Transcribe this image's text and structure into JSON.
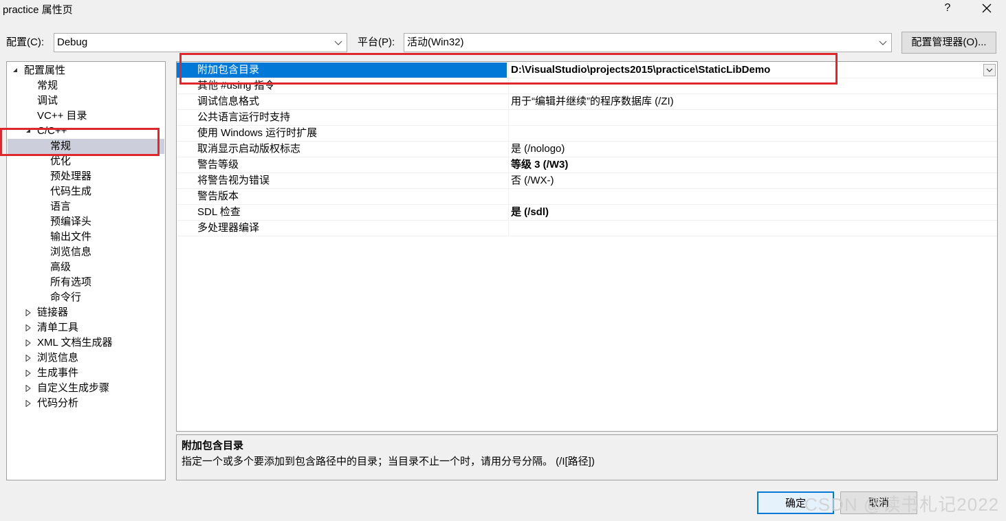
{
  "window": {
    "title": "practice 属性页",
    "help": "?",
    "close": "✕"
  },
  "toolbar": {
    "config_label": "配置(C):",
    "config_value": "Debug",
    "platform_label": "平台(P):",
    "platform_value": "活动(Win32)",
    "config_manager_label": "配置管理器(O)..."
  },
  "tree": {
    "root": "配置属性",
    "items": [
      "常规",
      "调试",
      "VC++ 目录"
    ],
    "cpp": {
      "label": "C/C++",
      "children": [
        "常规",
        "优化",
        "预处理器",
        "代码生成",
        "语言",
        "预编译头",
        "输出文件",
        "浏览信息",
        "高级",
        "所有选项",
        "命令行"
      ],
      "selected": "常规"
    },
    "collapsed": [
      "链接器",
      "清单工具",
      "XML 文档生成器",
      "浏览信息",
      "生成事件",
      "自定义生成步骤",
      "代码分析"
    ]
  },
  "grid": {
    "rows": [
      {
        "name": "附加包含目录",
        "value": "D:\\VisualStudio\\projects2015\\practice\\StaticLibDemo"
      },
      {
        "name": "其他 #using 指令",
        "value": ""
      },
      {
        "name": "调试信息格式",
        "value": "用于“编辑并继续”的程序数据库 (/ZI)"
      },
      {
        "name": "公共语言运行时支持",
        "value": ""
      },
      {
        "name": "使用 Windows 运行时扩展",
        "value": ""
      },
      {
        "name": "取消显示启动版权标志",
        "value": "是 (/nologo)"
      },
      {
        "name": "警告等级",
        "value": "等级 3 (/W3)"
      },
      {
        "name": "将警告视为错误",
        "value": "否 (/WX-)"
      },
      {
        "name": "警告版本",
        "value": ""
      },
      {
        "name": "SDL 检查",
        "value": "是 (/sdl)"
      },
      {
        "name": "多处理器编译",
        "value": ""
      }
    ]
  },
  "description": {
    "title": "附加包含目录",
    "text": "指定一个或多个要添加到包含路径中的目录；当目录不止一个时，请用分号分隔。     (/I[路径])"
  },
  "buttons": {
    "ok": "确定",
    "cancel": "取消"
  },
  "watermark": "CSDN @读书札记2022",
  "colors": {
    "selection_blue": "#0078d7",
    "annotation_red": "#e0262d",
    "tree_selection": "#cccedb"
  }
}
